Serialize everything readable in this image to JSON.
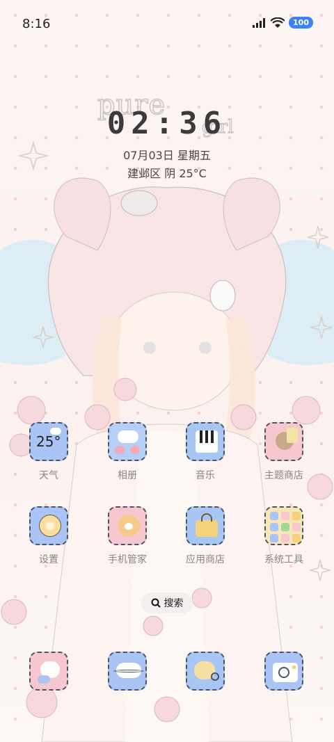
{
  "status_bar": {
    "time": "8:16",
    "battery": "100"
  },
  "wallpaper": {
    "text1": "pure",
    "text2": "girl"
  },
  "lockclock": {
    "time": "02:36",
    "date": "07月03日 星期五",
    "location_weather": "建邺区 阴 25°C"
  },
  "apps": {
    "row1": [
      {
        "label": "天气",
        "tile_text": "25°",
        "color": "#a9c4f5"
      },
      {
        "label": "相册",
        "color": "#b7cff7"
      },
      {
        "label": "音乐",
        "color": "#a8c6f4"
      },
      {
        "label": "主题商店",
        "color": "#f7c7d0"
      }
    ],
    "row2": [
      {
        "label": "设置",
        "color": "#a9c4f5"
      },
      {
        "label": "手机管家",
        "color": "#f7c7d0"
      },
      {
        "label": "应用商店",
        "color": "#a8c6f4"
      },
      {
        "label": "系统工具",
        "color": "#f6e6b8"
      }
    ]
  },
  "search": {
    "label": "搜索"
  },
  "dock": [
    {
      "name": "phone-dock",
      "color": "#f7c7d0"
    },
    {
      "name": "messages-dock",
      "color": "#a9c4f5"
    },
    {
      "name": "browser-dock",
      "color": "#a8c6f4"
    },
    {
      "name": "camera-dock",
      "color": "#a9c4f5"
    }
  ],
  "colors": {
    "accent": "#3b82f6",
    "outline": "#4b5366"
  }
}
